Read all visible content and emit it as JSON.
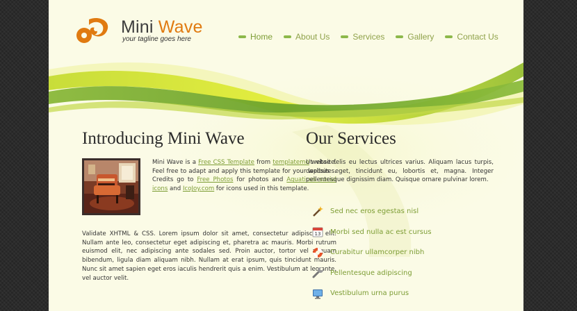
{
  "logo": {
    "title_part1": "Mini ",
    "title_part2": "Wave",
    "tagline": "your tagline goes here"
  },
  "nav": [
    {
      "label": "Home",
      "active": true
    },
    {
      "label": "About Us",
      "active": false
    },
    {
      "label": "Services",
      "active": false
    },
    {
      "label": "Gallery",
      "active": false
    },
    {
      "label": "Contact Us",
      "active": false
    }
  ],
  "intro": {
    "title": "Introducing Mini Wave",
    "p1_a": "Mini Wave is a ",
    "link1": "Free CSS Template",
    "p1_b": " from ",
    "link2": "templatemo",
    "p1_c": " website. Feel free to adapt and apply this template for your websites. Credits go to ",
    "link3": "Free Photos",
    "p1_d": " for photos and ",
    "link4": "Aquaticus social icons",
    "p1_e": " and ",
    "link5": "IcoJoy.com",
    "p1_f": " for icons used in this template.",
    "p2": "Validate XHTML & CSS. Lorem ipsum dolor sit amet, consectetur adipiscing elit. Nullam ante leo, consectetur eget adipiscing et, pharetra ac mauris. Morbi rutrum euismod elit, nec adipiscing ante sodales sed. Proin auctor, tortor vel aliquam bibendum, ligula diam aliquam nibh. Nullam at erat ipsum, quis tincidunt mauris. Nunc sit amet sapien eget eros iaculis hendrerit quis a enim. Vestibulum at leo ante, vel auctor velit."
  },
  "services": {
    "title": "Our Services",
    "text": "Ut vitae felis eu lectus ultrices varius. Aliquam lacus turpis, dapibus eget, tincidunt eu, lobortis et, magna. Integer pellentesque dignissim diam. Quisque ornare pulvinar lorem.",
    "items": [
      {
        "label": "Sed nec eros egestas nisl",
        "icon": "magic-wand-icon"
      },
      {
        "label": "Morbi sed nulla ac est cursus",
        "icon": "calendar-icon"
      },
      {
        "label": "Curabitur ullamcorper nibh",
        "icon": "lifebuoy-icon"
      },
      {
        "label": "Pellentesque adipiscing",
        "icon": "wrench-icon"
      },
      {
        "label": "Vestibulum urna purus",
        "icon": "monitor-icon"
      }
    ]
  },
  "colors": {
    "accent_orange": "#e07a10",
    "link_green": "#7d9d35",
    "page_bg": "#fbfbe6",
    "outer_bg": "#2b2b2b"
  }
}
